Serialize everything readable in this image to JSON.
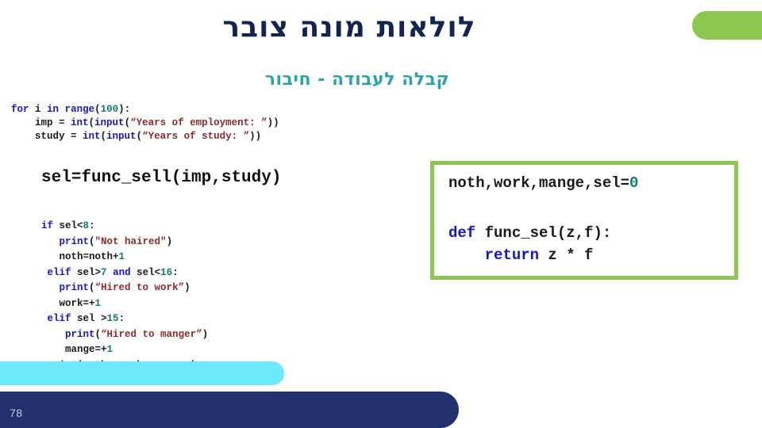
{
  "slide": {
    "title": "לולאות מונה צובר",
    "subtitle": "קבלה לעבודה - חיבור",
    "page_number": "78",
    "colors": {
      "title_navy": "#122452",
      "subtitle_teal": "#2BA3AC",
      "accent_green": "#8CC74F",
      "accent_cyan": "#6EE9F9",
      "accent_navy": "#22306E",
      "code_keyword": "#1414CC",
      "code_string": "#8B2B2B",
      "code_number": "#137B6E"
    }
  },
  "code_top": {
    "lines": [
      [
        {
          "t": "for",
          "c": "kw"
        },
        {
          "t": " i ",
          "c": "pl"
        },
        {
          "t": "in",
          "c": "kw"
        },
        {
          "t": " ",
          "c": "pl"
        },
        {
          "t": "range",
          "c": "fn"
        },
        {
          "t": "(",
          "c": "pl"
        },
        {
          "t": "100",
          "c": "num"
        },
        {
          "t": "):",
          "c": "pl"
        }
      ],
      [
        {
          "t": "    imp = ",
          "c": "pl"
        },
        {
          "t": "int",
          "c": "fn"
        },
        {
          "t": "(",
          "c": "pl"
        },
        {
          "t": "input",
          "c": "fn"
        },
        {
          "t": "(",
          "c": "pl"
        },
        {
          "t": "“Years of employment: ”",
          "c": "str"
        },
        {
          "t": "))",
          "c": "pl"
        }
      ],
      [
        {
          "t": "    study = ",
          "c": "pl"
        },
        {
          "t": "int",
          "c": "fn"
        },
        {
          "t": "(",
          "c": "pl"
        },
        {
          "t": "input",
          "c": "fn"
        },
        {
          "t": "(",
          "c": "pl"
        },
        {
          "t": "“Years of study: ”",
          "c": "str"
        },
        {
          "t": "))",
          "c": "pl"
        }
      ]
    ]
  },
  "code_call": {
    "text": "sel=func_sell(imp,study)"
  },
  "code_if": {
    "lines": [
      [
        {
          "t": "if",
          "c": "kw"
        },
        {
          "t": " sel<",
          "c": "pl"
        },
        {
          "t": "8",
          "c": "num"
        },
        {
          "t": ":",
          "c": "pl"
        }
      ],
      [
        {
          "t": "   ",
          "c": "pl"
        },
        {
          "t": "print",
          "c": "fn"
        },
        {
          "t": "(",
          "c": "pl"
        },
        {
          "t": "\"Not haired\"",
          "c": "str"
        },
        {
          "t": ")",
          "c": "pl"
        }
      ],
      [
        {
          "t": "   noth=noth+",
          "c": "pl"
        },
        {
          "t": "1",
          "c": "num"
        }
      ],
      [
        {
          "t": " ",
          "c": "pl"
        },
        {
          "t": "elif",
          "c": "kw"
        },
        {
          "t": " sel>",
          "c": "pl"
        },
        {
          "t": "7",
          "c": "num"
        },
        {
          "t": " ",
          "c": "pl"
        },
        {
          "t": "and",
          "c": "kw"
        },
        {
          "t": " sel<",
          "c": "pl"
        },
        {
          "t": "16",
          "c": "num"
        },
        {
          "t": ":",
          "c": "pl"
        }
      ],
      [
        {
          "t": "   ",
          "c": "pl"
        },
        {
          "t": "print",
          "c": "fn"
        },
        {
          "t": "(",
          "c": "pl"
        },
        {
          "t": "“Hired to work”",
          "c": "str"
        },
        {
          "t": ")",
          "c": "pl"
        }
      ],
      [
        {
          "t": "   work=+",
          "c": "pl"
        },
        {
          "t": "1",
          "c": "num"
        }
      ],
      [
        {
          "t": " ",
          "c": "pl"
        },
        {
          "t": "elif",
          "c": "kw"
        },
        {
          "t": " sel >",
          "c": "pl"
        },
        {
          "t": "15",
          "c": "num"
        },
        {
          "t": ":",
          "c": "pl"
        }
      ],
      [
        {
          "t": "    ",
          "c": "pl"
        },
        {
          "t": "print",
          "c": "fn"
        },
        {
          "t": "(",
          "c": "pl"
        },
        {
          "t": "“Hired to manger”",
          "c": "str"
        },
        {
          "t": ")",
          "c": "pl"
        }
      ],
      [
        {
          "t": "    mange=+",
          "c": "pl"
        },
        {
          "t": "1",
          "c": "num"
        }
      ],
      [
        {
          "t": " ",
          "c": "pl"
        },
        {
          "t": "print",
          "c": "fn"
        },
        {
          "t": "(noth, work, manage)",
          "c": "pl"
        }
      ]
    ]
  },
  "green_box": {
    "line_1": [
      {
        "t": "noth,work,mange,sel=",
        "c": "pl"
      },
      {
        "t": "0",
        "c": "num"
      }
    ],
    "line_2": [
      {
        "t": "def",
        "c": "kw"
      },
      {
        "t": " func_sel(z,f):\n    ",
        "c": "pl"
      },
      {
        "t": "return",
        "c": "kw"
      },
      {
        "t": " z * f",
        "c": "pl"
      }
    ]
  }
}
